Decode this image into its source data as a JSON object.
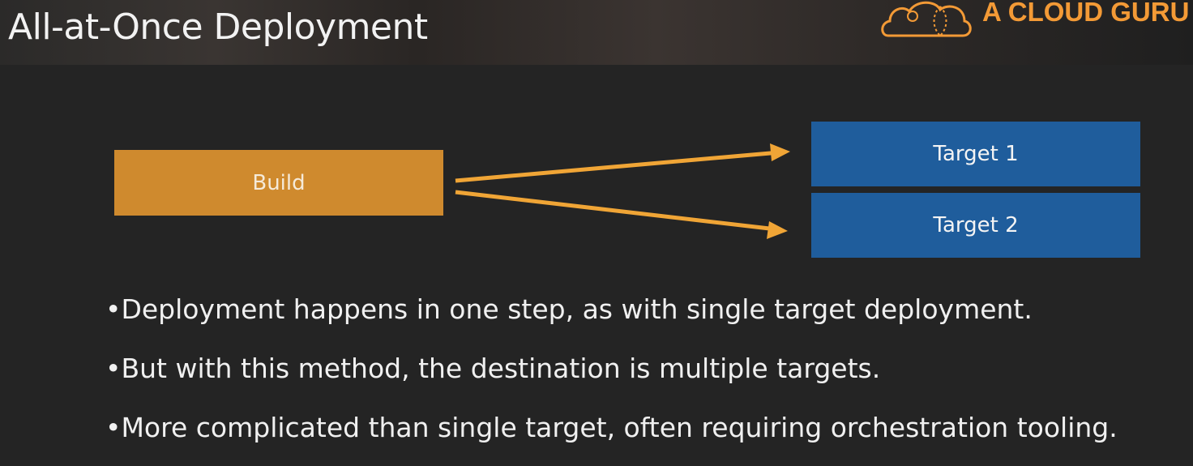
{
  "slide": {
    "title": "All-at-Once Deployment"
  },
  "logo": {
    "text": "A CLOUD GURU",
    "color": "#f39a36"
  },
  "diagram": {
    "build_label": "Build",
    "targets": [
      {
        "label": "Target 1"
      },
      {
        "label": "Target 2"
      }
    ],
    "colors": {
      "build": "#cf8a2e",
      "target": "#1f5d9c",
      "arrow": "#f0a536"
    }
  },
  "bullets": [
    {
      "text": "•Deployment happens in one step, as with single target deployment."
    },
    {
      "text": "•But with this method, the destination is multiple targets."
    },
    {
      "text": "•More complicated than single target, often requiring orchestration tooling."
    }
  ]
}
